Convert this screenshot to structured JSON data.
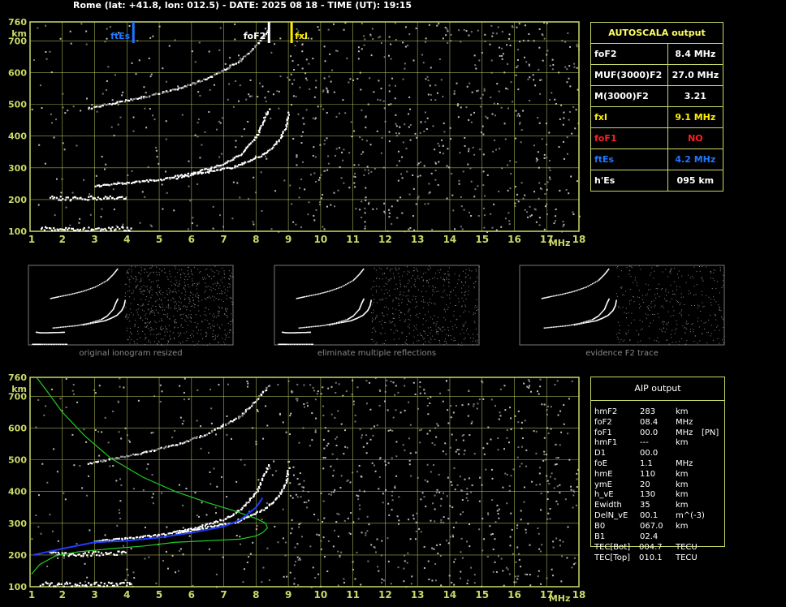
{
  "header": {
    "title": "Rome (lat: +41.8, lon: 012.5) - DATE: 2025 08 18 - TIME (UT): 19:15"
  },
  "axes": {
    "x_ticks": [
      "1",
      "2",
      "3",
      "4",
      "5",
      "6",
      "7",
      "8",
      "9",
      "10",
      "11",
      "12",
      "13",
      "14",
      "15",
      "16",
      "17",
      "18"
    ],
    "x_unit": "MHz",
    "y_ticks": [
      "100",
      "200",
      "300",
      "400",
      "500",
      "600",
      "700",
      "760"
    ],
    "y_unit": "km"
  },
  "markers": {
    "ftEs": {
      "label": "ftEs",
      "freq": 4.2,
      "color": "#1e78ff"
    },
    "foF2": {
      "label": "foF2",
      "freq": 8.4,
      "color": "#ffffff"
    },
    "fxI": {
      "label": "fxI",
      "freq": 9.1,
      "color": "#ffee00"
    }
  },
  "autoscala": {
    "title": "AUTOSCALA output",
    "rows": [
      {
        "label": "foF2",
        "value": "8.4 MHz",
        "color": "#ffffff"
      },
      {
        "label": "MUF(3000)F2",
        "value": "27.0 MHz",
        "color": "#ffffff"
      },
      {
        "label": "M(3000)F2",
        "value": "3.21",
        "color": "#ffffff"
      },
      {
        "label": "fxI",
        "value": "9.1 MHz",
        "color": "#ffee00"
      },
      {
        "label": "foF1",
        "value": "NO",
        "color": "#ff2020"
      },
      {
        "label": "ftEs",
        "value": "4.2 MHz",
        "color": "#1e78ff"
      },
      {
        "label": "h'Es",
        "value": "095     km",
        "color": "#ffffff"
      }
    ]
  },
  "thumbnails": [
    {
      "caption": "original ionogram resized"
    },
    {
      "caption": "eliminate multiple reflections"
    },
    {
      "caption": "evidence F2 trace"
    }
  ],
  "aip": {
    "title": "AIP output",
    "rows": [
      {
        "name": "hmF2",
        "value": "283",
        "unit": "km",
        "extra": ""
      },
      {
        "name": "foF2",
        "value": "08.4",
        "unit": "MHz",
        "extra": ""
      },
      {
        "name": "foF1",
        "value": "00.0",
        "unit": "MHz",
        "extra": "[PN]"
      },
      {
        "name": "hmF1",
        "value": "---",
        "unit": "km",
        "extra": ""
      },
      {
        "name": "D1",
        "value": "00.0",
        "unit": "",
        "extra": ""
      },
      {
        "name": "foE",
        "value": "1.1",
        "unit": "MHz",
        "extra": ""
      },
      {
        "name": "hmE",
        "value": "110",
        "unit": "km",
        "extra": ""
      },
      {
        "name": "ymE",
        "value": "20",
        "unit": "km",
        "extra": ""
      },
      {
        "name": "h_vE",
        "value": "130",
        "unit": "km",
        "extra": ""
      },
      {
        "name": "Ewidth",
        "value": "35",
        "unit": "km",
        "extra": ""
      },
      {
        "name": "DelN_vE",
        "value": "00.1",
        "unit": "m^(-3)",
        "extra": ""
      },
      {
        "name": "B0",
        "value": "067.0",
        "unit": "km",
        "extra": ""
      },
      {
        "name": "B1",
        "value": "02.4",
        "unit": "",
        "extra": ""
      }
    ],
    "tec": [
      {
        "name": "TEC[Bot]",
        "value": "004.7",
        "unit": "TECU"
      },
      {
        "name": "TEC[Top]",
        "value": "010.1",
        "unit": "TECU"
      }
    ]
  },
  "colors": {
    "grid": "#ccd966",
    "profile": "#22cc22",
    "fit": "#1e3cff",
    "trace": "#ffffff"
  },
  "chart_data": [
    {
      "type": "scatter",
      "title": "Rome (lat: +41.8, lon: 012.5) - DATE: 2025 08 18 - TIME (UT): 19:15",
      "xlabel": "MHz",
      "ylabel": "km",
      "xlim": [
        1,
        18
      ],
      "ylim": [
        100,
        760
      ],
      "grid": true,
      "series": [
        {
          "name": "",
          "x": [
            1.3,
            2,
            3,
            4,
            4.15
          ],
          "y": [
            110,
            110,
            110,
            110,
            110
          ]
        },
        {
          "name": "",
          "x": [
            1.6,
            2,
            2.5,
            3,
            3.5,
            4.0
          ],
          "y": [
            210,
            205,
            205,
            207,
            208,
            210
          ]
        },
        {
          "name": "",
          "x": [
            3.0,
            4.0,
            5.0,
            6.0,
            7.0,
            7.5,
            8.0,
            8.2,
            8.4
          ],
          "y": [
            245,
            255,
            265,
            285,
            315,
            345,
            400,
            450,
            490
          ]
        },
        {
          "name": "",
          "x": [
            5.5,
            6.5,
            7.3,
            7.8,
            8.3,
            8.7,
            8.9,
            9.0
          ],
          "y": [
            270,
            290,
            305,
            325,
            350,
            390,
            430,
            480
          ]
        },
        {
          "name": "",
          "x": [
            2.8,
            3.5,
            4.5,
            5.5,
            6.5,
            7.5,
            8.0,
            8.4
          ],
          "y": [
            490,
            505,
            525,
            550,
            585,
            640,
            690,
            740
          ]
        }
      ]
    },
    {
      "type": "line",
      "xlabel": "MHz",
      "ylabel": "km",
      "xlim": [
        1,
        18
      ],
      "ylim": [
        100,
        760
      ],
      "grid": true,
      "series": [
        {
          "name": "",
          "x": [
            1.2,
            1.5,
            2.0,
            2.7,
            3.5,
            4.5,
            5.5,
            6.5,
            7.3,
            8.0,
            8.3,
            8.35,
            8.2,
            8.0,
            7.5,
            6.5,
            5.5,
            4.5,
            3.5,
            2.5,
            1.8,
            1.3,
            1.05
          ],
          "y": [
            760,
            720,
            650,
            575,
            505,
            445,
            400,
            365,
            340,
            315,
            300,
            285,
            270,
            260,
            250,
            245,
            240,
            228,
            220,
            210,
            198,
            170,
            140
          ]
        },
        {
          "name": "",
          "x": [
            1.1,
            2,
            3,
            4,
            5,
            6,
            7,
            7.5,
            8.0,
            8.2
          ],
          "y": [
            200,
            220,
            240,
            245,
            255,
            270,
            290,
            310,
            350,
            380
          ]
        }
      ]
    }
  ]
}
